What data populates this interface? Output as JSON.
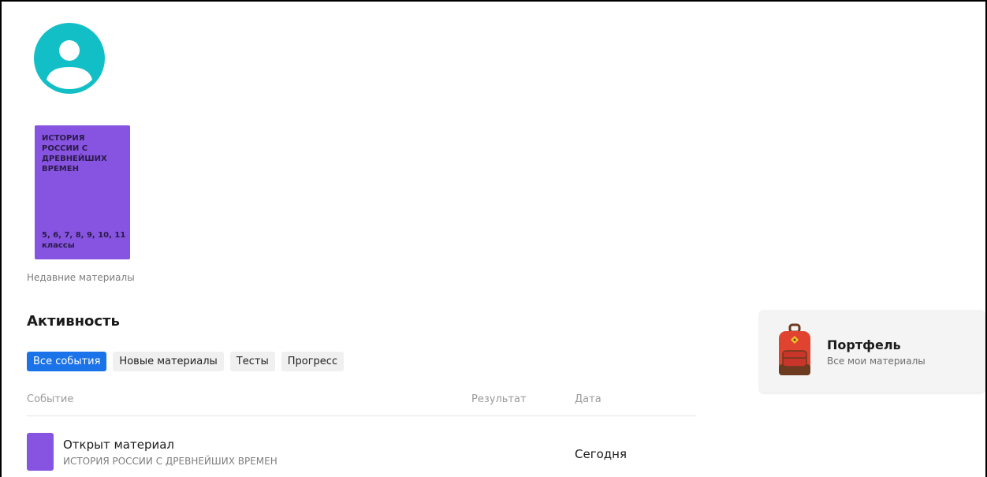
{
  "profile": {
    "avatar_icon": "user-avatar-icon",
    "avatar_color": "#13bfc6"
  },
  "recent": {
    "book": {
      "title": "ИСТОРИЯ РОССИИ С ДРЕВНЕЙШИХ ВРЕМЕН",
      "grades": "5, 6, 7, 8, 9, 10, 11 классы",
      "color": "#8654e0"
    },
    "label": "Недавние материалы"
  },
  "activity": {
    "title": "Активность",
    "tabs": [
      {
        "label": "Все события",
        "active": true
      },
      {
        "label": "Новые материалы",
        "active": false
      },
      {
        "label": "Тесты",
        "active": false
      },
      {
        "label": "Прогресс",
        "active": false
      }
    ],
    "columns": {
      "event": "Событие",
      "result": "Результат",
      "date": "Дата"
    },
    "rows": [
      {
        "title": "Открыт материал",
        "subtitle": "ИСТОРИЯ РОССИИ С ДРЕВНЕЙШИХ ВРЕМЕН",
        "result": "",
        "date": "Сегодня",
        "thumb_color": "#8654e0"
      }
    ]
  },
  "portfolio": {
    "icon": "backpack-icon",
    "title": "Портфель",
    "subtitle": "Все мои материалы"
  },
  "colors": {
    "accent": "#1a73e8",
    "tab_bg": "#f0f0f0",
    "card_bg": "#f4f4f5"
  }
}
